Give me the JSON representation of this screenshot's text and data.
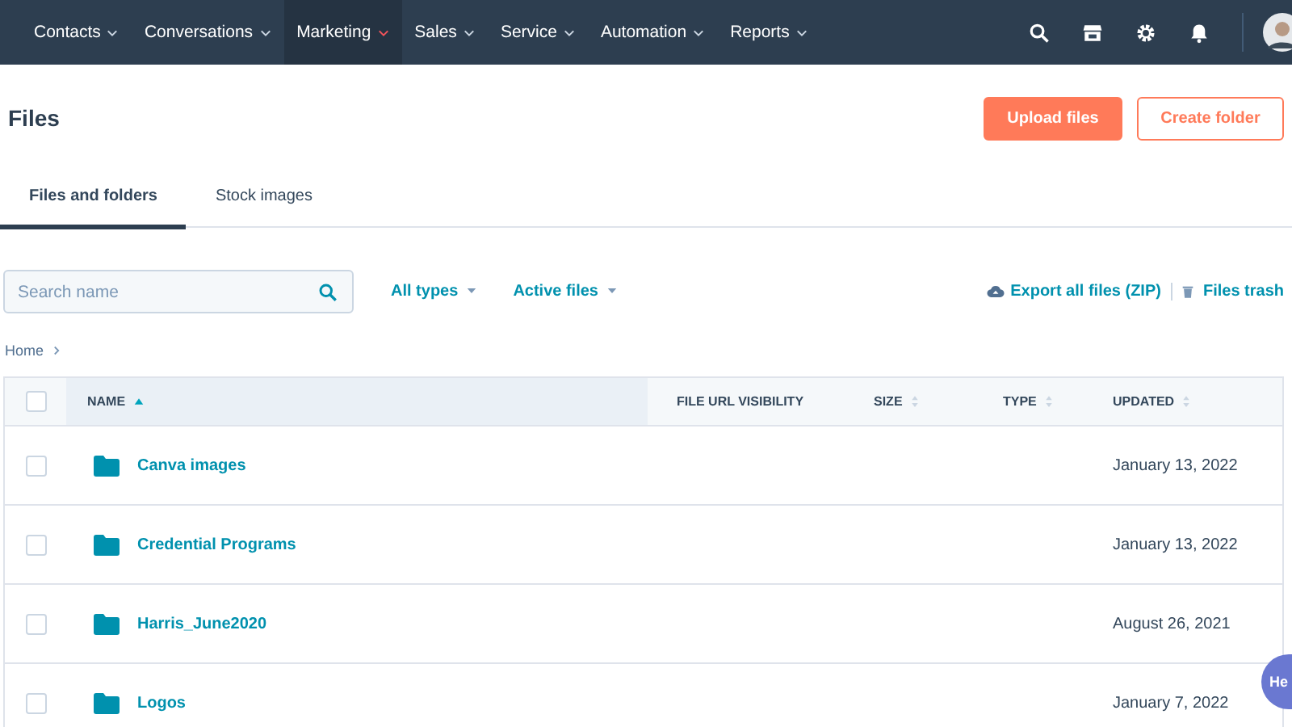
{
  "nav": {
    "items": [
      {
        "label": "Contacts",
        "selected": false
      },
      {
        "label": "Conversations",
        "selected": false
      },
      {
        "label": "Marketing",
        "selected": true
      },
      {
        "label": "Sales",
        "selected": false
      },
      {
        "label": "Service",
        "selected": false
      },
      {
        "label": "Automation",
        "selected": false
      },
      {
        "label": "Reports",
        "selected": false
      }
    ]
  },
  "page": {
    "title": "Files",
    "buttons": [
      {
        "label": "Upload files",
        "kind": "primary"
      },
      {
        "label": "Create folder",
        "kind": "secondary"
      }
    ]
  },
  "tabs": [
    {
      "label": "Files and folders",
      "selected": true
    },
    {
      "label": "Stock images",
      "selected": false
    }
  ],
  "toolbar": {
    "search": {
      "placeholder": "Search name"
    },
    "filters": [
      "All types",
      "Active files"
    ],
    "export_link": "Export all files (ZIP)",
    "trash_link": "Files trash"
  },
  "breadcrumb": [
    "Home"
  ],
  "table": {
    "select_all_checked": false,
    "columns": [
      {
        "label": "NAME",
        "sortable": true,
        "sorted": true
      },
      {
        "label": "FILE URL VISIBILITY",
        "sortable": false,
        "sorted": false
      },
      {
        "label": "SIZE",
        "sortable": true,
        "sorted": false
      },
      {
        "label": "TYPE",
        "sortable": true,
        "sorted": false
      },
      {
        "label": "UPDATED",
        "sortable": true,
        "sorted": false
      }
    ],
    "rows": [
      {
        "name": "Canva images",
        "updated": "January 13, 2022",
        "checked": false
      },
      {
        "name": "Credential Programs",
        "updated": "January 13, 2022",
        "checked": false
      },
      {
        "name": "Harris_June2020",
        "updated": "August 26, 2021",
        "checked": false
      },
      {
        "name": "Logos",
        "updated": "January 7, 2022",
        "checked": false
      }
    ]
  },
  "help": {
    "label": "He"
  }
}
